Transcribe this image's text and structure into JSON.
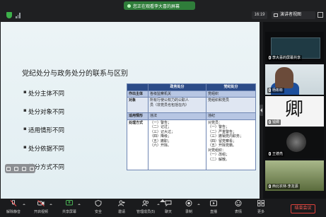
{
  "window": {
    "share_banner": "您正在观看李大喜的屏幕",
    "clock": "16:19",
    "view_mode": "演讲者视图"
  },
  "slide": {
    "title": "党纪处分与政务处分的联系与区别",
    "bullets": [
      "处分主体不同",
      "处分对象不同",
      "适用情形不同",
      "处分依据不同",
      "处分方式不同"
    ],
    "table": {
      "headers": [
        "",
        "政务处分",
        "党纪处分"
      ],
      "rows": [
        {
          "head": "作出主体",
          "col1": [
            "各级监察机关"
          ],
          "col2": [
            "党组织"
          ]
        },
        {
          "head": "对象",
          "col1": [
            "所有行使公权力的公职人",
            "员（非党员也包括在内）"
          ],
          "col2": [
            "党组织和党员"
          ]
        },
        {
          "head": "适用情形",
          "col1": [
            "违法"
          ],
          "col2": [
            "违纪"
          ]
        },
        {
          "head": "处理方式",
          "col1": [
            "（一）警告；",
            "（二）记过；",
            "（三）记大过；",
            "（四）降级；",
            "（五）撤职；",
            "（六）开除。"
          ],
          "col2": [
            "对党员：",
            "（一）警告；",
            "（二）严重警告；",
            "（三）撤销党内职务；",
            "（四）留党察看；",
            "（五）开除党籍。",
            "对党组织：",
            "（一）改组；",
            "（二）解散。"
          ]
        }
      ]
    }
  },
  "participants": [
    {
      "name": "李大喜的屏幕共享"
    },
    {
      "name": "杨彬彬"
    },
    {
      "name": "钱卿",
      "avatar_glyph": "卿"
    },
    {
      "name": "王德亮"
    },
    {
      "name": "西北农林·李龙源"
    }
  ],
  "toolbar": {
    "items": [
      {
        "label": "解除静音",
        "icon": "mic-muted-icon"
      },
      {
        "label": "开启视频",
        "icon": "video-off-icon"
      },
      {
        "label": "共享屏幕",
        "icon": "share-screen-icon"
      },
      {
        "label": "安全",
        "icon": "shield-icon"
      },
      {
        "label": "邀请",
        "icon": "invite-icon"
      },
      {
        "label": "管理成员(5)",
        "icon": "members-icon"
      },
      {
        "label": "聊天",
        "icon": "chat-icon"
      },
      {
        "label": "录制",
        "icon": "record-icon"
      },
      {
        "label": "直播",
        "icon": "live-icon"
      },
      {
        "label": "表情",
        "icon": "emoji-icon"
      },
      {
        "label": "更多",
        "icon": "more-icon"
      }
    ],
    "leave_label": "结束会议"
  },
  "colors": {
    "table_header": "#2c4c88",
    "leave_red": "#e0423c",
    "share_green": "#2f7d3a"
  }
}
